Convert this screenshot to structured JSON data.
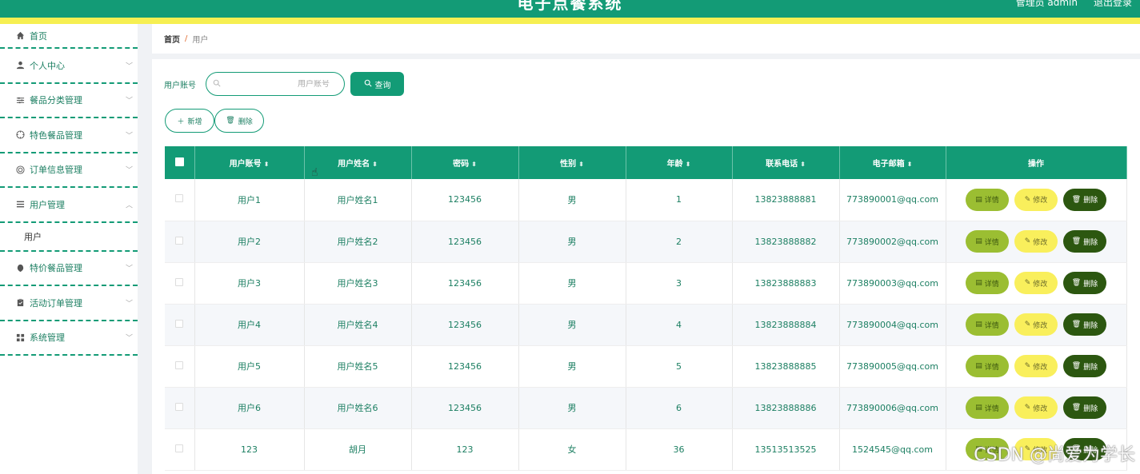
{
  "header": {
    "title": "电子点餐系统",
    "right_links": [
      "管理员 admin",
      "退出登录"
    ]
  },
  "sidebar": {
    "items": [
      {
        "label": "首页",
        "icon": "home-icon",
        "has_chevron": false
      },
      {
        "label": "个人中心",
        "icon": "user-icon",
        "has_chevron": true
      },
      {
        "label": "餐品分类管理",
        "icon": "sliders-icon",
        "has_chevron": true
      },
      {
        "label": "特色餐品管理",
        "icon": "compass-icon",
        "has_chevron": true
      },
      {
        "label": "订单信息管理",
        "icon": "target-icon",
        "has_chevron": true
      },
      {
        "label": "用户管理",
        "icon": "menu-icon",
        "has_chevron": true,
        "expanded": true,
        "children": [
          {
            "label": "用户"
          }
        ]
      },
      {
        "label": "特价餐品管理",
        "icon": "tag-icon",
        "has_chevron": true
      },
      {
        "label": "活动订单管理",
        "icon": "clipboard-icon",
        "has_chevron": true
      },
      {
        "label": "系统管理",
        "icon": "grid-icon",
        "has_chevron": true
      }
    ]
  },
  "breadcrumb": {
    "home": "首页",
    "sep": "/",
    "current": "用户"
  },
  "search": {
    "label": "用户账号",
    "placeholder": "用户账号",
    "value": "",
    "button": "查询"
  },
  "actions": {
    "add": "新增",
    "delete": "删除"
  },
  "table": {
    "columns": [
      "用户账号",
      "用户姓名",
      "密码",
      "性别",
      "年龄",
      "联系电话",
      "电子邮箱",
      "操作"
    ],
    "op_labels": {
      "detail": "详情",
      "edit": "修改",
      "delete": "删除"
    },
    "rows": [
      [
        "用户1",
        "用户姓名1",
        "123456",
        "男",
        "1",
        "13823888881",
        "773890001@qq.com"
      ],
      [
        "用户2",
        "用户姓名2",
        "123456",
        "男",
        "2",
        "13823888882",
        "773890002@qq.com"
      ],
      [
        "用户3",
        "用户姓名3",
        "123456",
        "男",
        "3",
        "13823888883",
        "773890003@qq.com"
      ],
      [
        "用户4",
        "用户姓名4",
        "123456",
        "男",
        "4",
        "13823888884",
        "773890004@qq.com"
      ],
      [
        "用户5",
        "用户姓名5",
        "123456",
        "男",
        "5",
        "13823888885",
        "773890005@qq.com"
      ],
      [
        "用户6",
        "用户姓名6",
        "123456",
        "男",
        "6",
        "13823888886",
        "773890006@qq.com"
      ],
      [
        "123",
        "胡月",
        "123",
        "女",
        "36",
        "13513513525",
        "1524545@qq.com"
      ]
    ]
  },
  "watermark": "CSDN @尚爱为学长",
  "colors": {
    "primary": "#139b76",
    "accent_yellow": "#f6ef52",
    "detail": "#9bbe32",
    "edit": "#f9ef5c",
    "delete": "#2c5710"
  }
}
